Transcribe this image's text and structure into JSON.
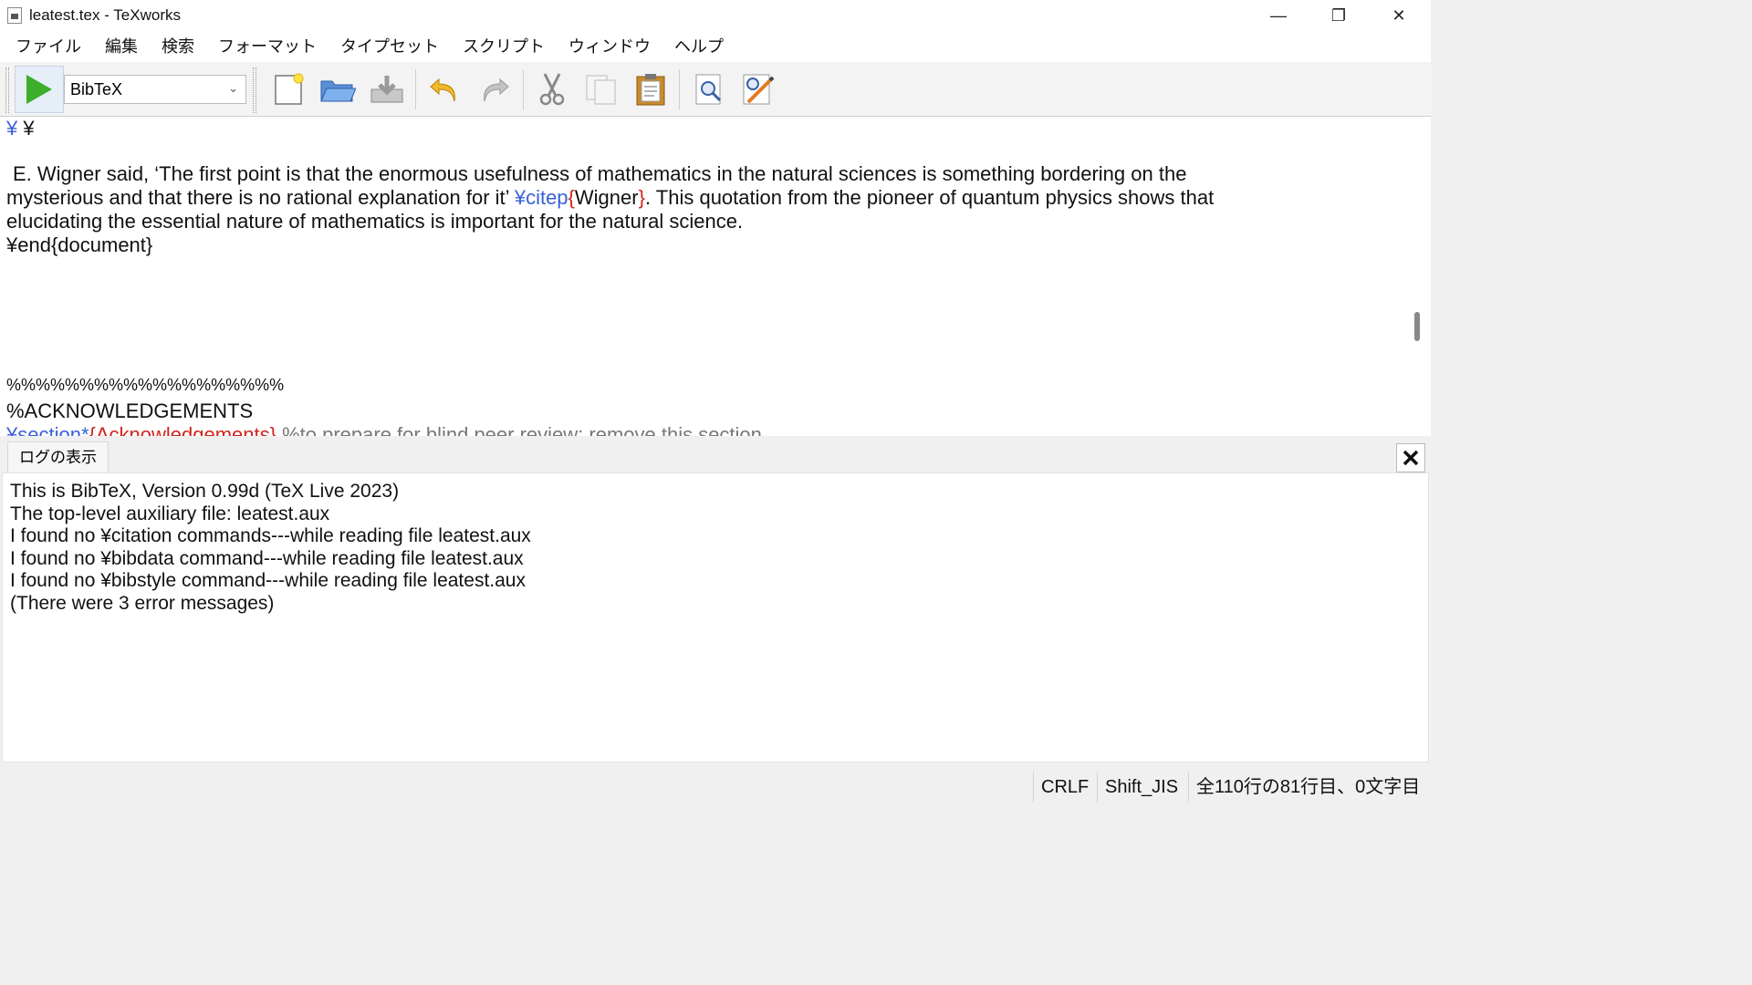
{
  "window": {
    "title": "leatest.tex - TeXworks",
    "minimize_glyph": "—",
    "maximize_glyph": "❐",
    "close_glyph": "✕"
  },
  "menu": {
    "items": [
      "ファイル",
      "編集",
      "検索",
      "フォーマット",
      "タイプセット",
      "スクリプト",
      "ウィンドウ",
      "ヘルプ"
    ]
  },
  "toolbar": {
    "engine": "BibTeX",
    "buttons": [
      "typeset-icon",
      "new-document-icon",
      "open-folder-icon",
      "save-icon",
      "undo-icon",
      "redo-icon",
      "cut-icon",
      "copy-icon",
      "paste-icon",
      "find-icon",
      "replace-icon"
    ]
  },
  "editor": {
    "line_yen_a": "¥",
    "line_yen_b": "¥",
    "para1": "E. Wigner said, ‘The first point is that the enormous usefulness of mathematics in the natural sciences is something bordering on the",
    "para2_a": "mysterious and that there is no rational explanation for it’ ",
    "para2_cmd": "¥citep",
    "para2_lbrace": "{",
    "para2_arg": "Wigner",
    "para2_rbrace": "}",
    "para2_b": ". This quotation from the pioneer of quantum physics shows that",
    "para3": "elucidating the essential nature of mathematics is important for the natural science.",
    "end_document": "¥end{document}",
    "percent_row": "%%%%%%%%%%%%%%%%%%%",
    "ack_comment": "%ACKNOWLEDGEMENTS",
    "section_cmd": "¥section*",
    "section_arg": "{Acknowledgements}",
    "section_comment": " %to prepare for blind peer review: remove this section"
  },
  "log": {
    "tab_label": "ログの表示",
    "lines": [
      "This is BibTeX, Version 0.99d (TeX Live 2023)",
      "The top-level auxiliary file: leatest.aux",
      "I found no ¥citation commands---while reading file leatest.aux",
      "I found no ¥bibdata command---while reading file leatest.aux",
      "I found no ¥bibstyle command---while reading file leatest.aux",
      "(There were 3 error messages)"
    ]
  },
  "status": {
    "line_ending": "CRLF",
    "encoding": "Shift_JIS",
    "position": "全110行の81行目、0文字目"
  }
}
